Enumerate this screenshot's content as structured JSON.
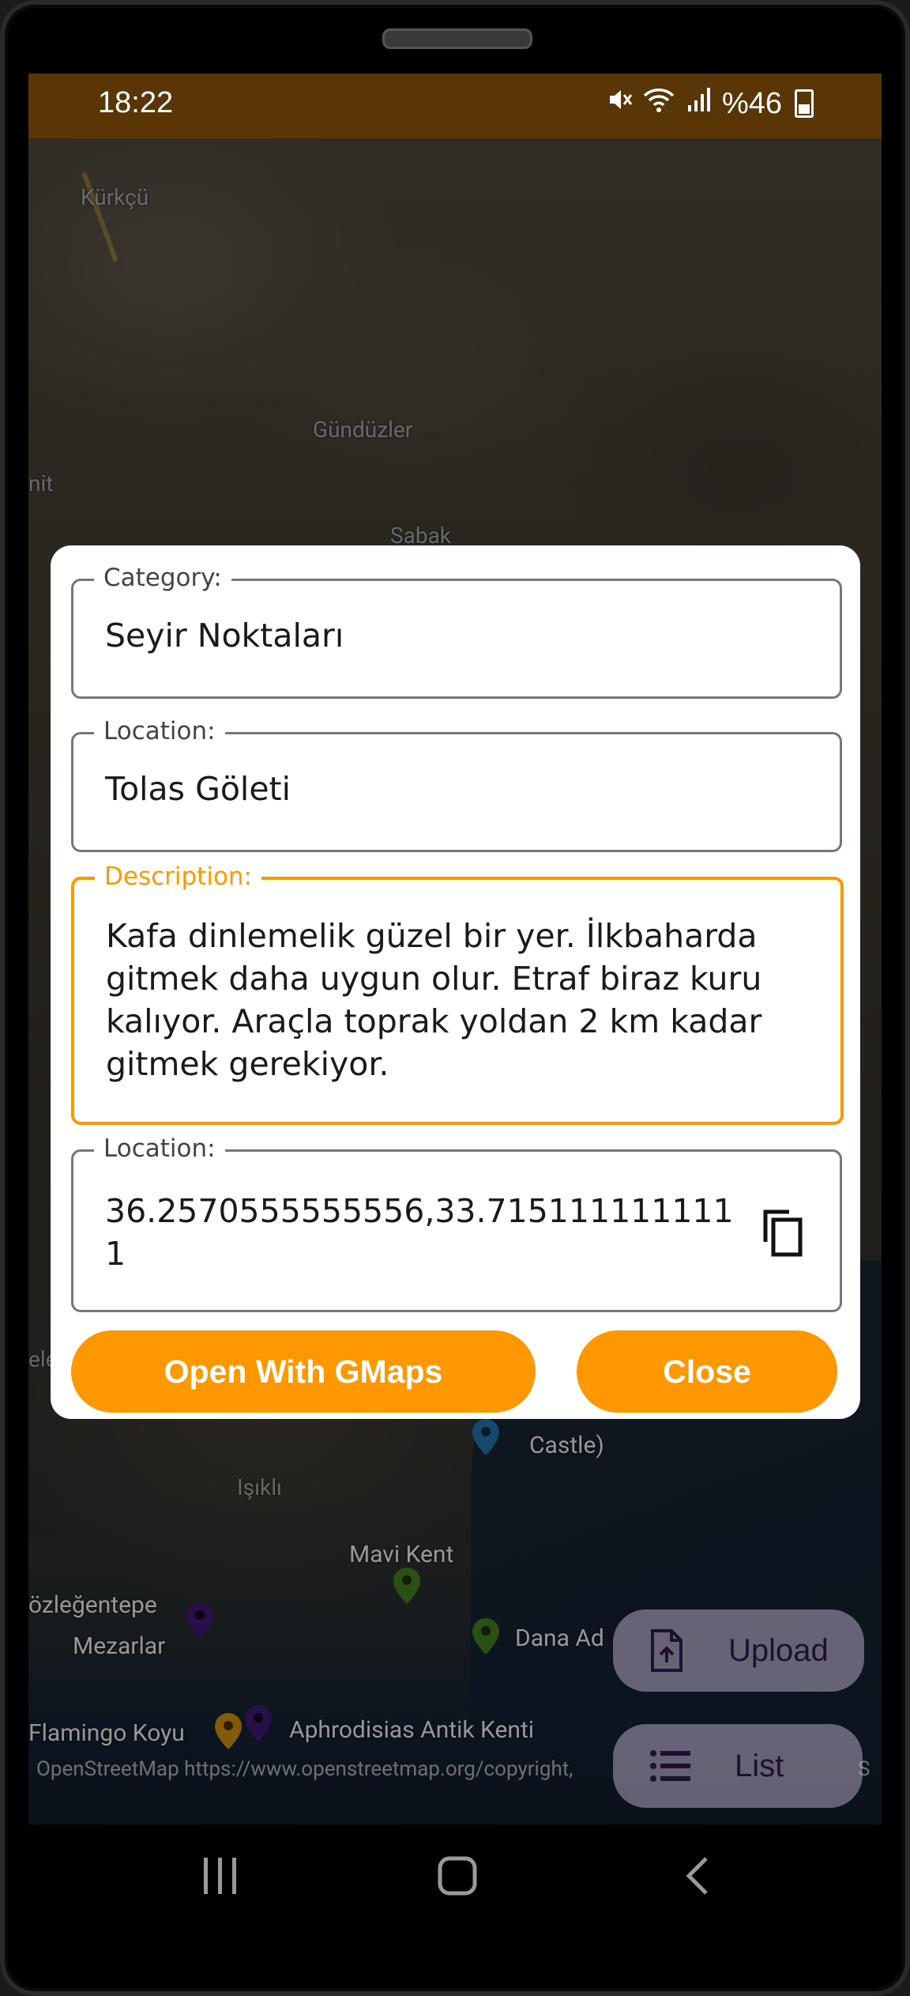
{
  "status_bar": {
    "time": "18:22",
    "battery": "%46",
    "icons": [
      "mute-icon",
      "wifi-icon",
      "signal-icon",
      "battery-icon"
    ]
  },
  "map": {
    "labels": {
      "kurkcu": "Kürkçü",
      "gunduzler": "Gündüzler",
      "nit": "nit",
      "sabak": "Sabak",
      "isikli": "Işıklı",
      "mavi_kent": "Mavi Kent",
      "gozlegentepe": "özleğentepe",
      "mezarlar": "Mezarlar",
      "dana_ad": "Dana Ad",
      "castle": "Castle)",
      "flamingo": "Flamingo Koyu",
      "aphrodisias": "Aphrodisias Antik Kenti",
      "ele": "ele"
    },
    "attribution": "OpenStreetMap https://www.openstreetmap.org/copyright,",
    "attribution_right": "S",
    "colors": {
      "marker_blue": "#1f6fa8",
      "marker_green": "#3f7d1f",
      "marker_purple": "#3d1a6e",
      "marker_orange": "#c98a10"
    }
  },
  "dialog": {
    "category_label": "Category:",
    "category_value": "Seyir Noktaları",
    "location_label": "Location:",
    "location_value": "Tolas Göleti",
    "description_label": "Description:",
    "description_value": "Kafa dinlemelik güzel bir yer. İlkbaharda gitmek daha uygun olur. Etraf biraz kuru kalıyor. Araçla  toprak yoldan 2 km kadar gitmek gerekiyor.",
    "coords_label": "Location:",
    "coords_value": "36.2570555555556,33.7151111111111",
    "open_button": "Open With GMaps",
    "close_button": "Close"
  },
  "fabs": {
    "upload": "Upload",
    "list": "List"
  },
  "colors": {
    "accent": "#ff9800",
    "status_bar": "#5a3606"
  }
}
